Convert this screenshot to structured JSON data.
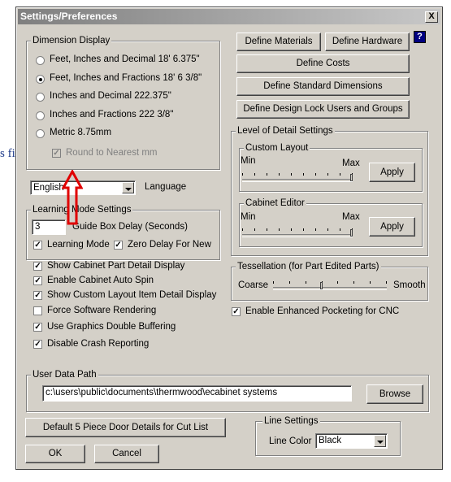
{
  "background_text": "s fi",
  "window": {
    "title": "Settings/Preferences",
    "close_label": "X"
  },
  "dimension_display": {
    "title": "Dimension Display",
    "options": [
      {
        "label": "Feet, Inches and Decimal 18' 6.375\"",
        "selected": false
      },
      {
        "label": "Feet, Inches and Fractions 18' 6 3/8\"",
        "selected": true
      },
      {
        "label": "Inches and Decimal 222.375\"",
        "selected": false
      },
      {
        "label": "Inches and Fractions 222 3/8\"",
        "selected": false
      },
      {
        "label": "Metric 8.75mm",
        "selected": false
      }
    ],
    "round_label": "Round to Nearest mm",
    "round_checked": true
  },
  "language": {
    "value": "English",
    "label": "Language"
  },
  "learning_mode": {
    "title": "Learning Mode Settings",
    "delay_value": "3",
    "delay_label": "Guide Box Delay (Seconds)",
    "learning_label": "Learning Mode",
    "learning_checked": true,
    "zero_delay_label": "Zero Delay For New",
    "zero_delay_checked": true
  },
  "options": [
    {
      "label": "Show Cabinet Part Detail Display",
      "checked": true
    },
    {
      "label": "Enable Cabinet Auto Spin",
      "checked": true
    },
    {
      "label": "Show Custom Layout Item Detail Display",
      "checked": true
    },
    {
      "label": "Force Software Rendering",
      "checked": false
    },
    {
      "label": "Use Graphics Double Buffering",
      "checked": true
    },
    {
      "label": "Disable Crash Reporting",
      "checked": true
    }
  ],
  "define_buttons": {
    "materials": "Define Materials",
    "hardware": "Define Hardware",
    "help": "?",
    "costs": "Define Costs",
    "standard_dimensions": "Define Standard Dimensions",
    "design_lock": "Define Design Lock Users and Groups"
  },
  "level_of_detail": {
    "title": "Level of Detail Settings",
    "custom_layout": {
      "title": "Custom Layout",
      "min": "Min",
      "max": "Max",
      "apply": "Apply",
      "level": 1.0
    },
    "cabinet_editor": {
      "title": "Cabinet Editor",
      "min": "Min",
      "max": "Max",
      "apply": "Apply",
      "level": 1.0
    }
  },
  "tessellation": {
    "title": "Tessellation (for Part Edited Parts)",
    "coarse": "Coarse",
    "smooth": "Smooth",
    "level": 0.42
  },
  "enhanced_pocketing": {
    "label": "Enable Enhanced Pocketing for CNC",
    "checked": true
  },
  "user_data_path": {
    "title": "User Data Path",
    "value": "c:\\users\\public\\documents\\thermwood\\ecabinet systems",
    "browse": "Browse"
  },
  "default_door_button": "Default 5 Piece Door Details for Cut List",
  "line_settings": {
    "title": "Line Settings",
    "color_label": "Line Color",
    "color_value": "Black"
  },
  "footer": {
    "ok": "OK",
    "cancel": "Cancel"
  },
  "colors": {
    "dialog_bg": "#d4d0c8",
    "annotation_arrow": "#e00000"
  }
}
